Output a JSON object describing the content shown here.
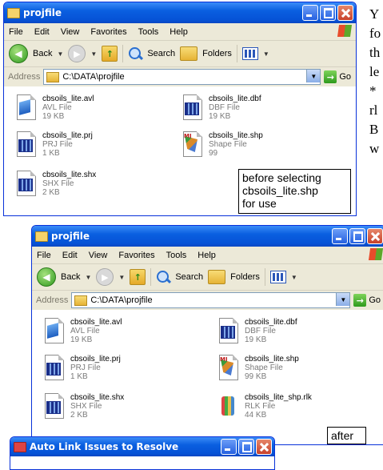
{
  "bg_text": [
    "Y",
    "fo",
    "th",
    "le",
    "*",
    "rl",
    "B",
    "w"
  ],
  "top_window": {
    "title": "projfile",
    "menu": [
      "File",
      "Edit",
      "View",
      "Favorites",
      "Tools",
      "Help"
    ],
    "toolbar": {
      "back": "Back",
      "search": "Search",
      "folders": "Folders"
    },
    "address": {
      "label": "Address",
      "path": "C:\\DATA\\projfile",
      "go": "Go"
    },
    "files": [
      {
        "name": "cbsoils_lite.avl",
        "type": "AVL File",
        "size": "19 KB",
        "icon": "avl-file-icon"
      },
      {
        "name": "cbsoils_lite.dbf",
        "type": "DBF File",
        "size": "19 KB",
        "icon": "dbf-file-icon"
      },
      {
        "name": "cbsoils_lite.prj",
        "type": "PRJ File",
        "size": "1 KB",
        "icon": "prj-file-icon"
      },
      {
        "name": "cbsoils_lite.shp",
        "type": "Shape File",
        "size": "99",
        "icon": "shape-file-icon"
      },
      {
        "name": "cbsoils_lite.shx",
        "type": "SHX File",
        "size": "2 KB",
        "icon": "shx-file-icon"
      }
    ]
  },
  "note_before": [
    "before selecting",
    "cbsoils_lite.shp",
    "for use"
  ],
  "bottom_window": {
    "title": "projfile",
    "menu": [
      "File",
      "Edit",
      "View",
      "Favorites",
      "Tools",
      "Help"
    ],
    "toolbar": {
      "back": "Back",
      "search": "Search",
      "folders": "Folders"
    },
    "address": {
      "label": "Address",
      "path": "C:\\DATA\\projfile",
      "go": "Go"
    },
    "files": [
      {
        "name": "cbsoils_lite.avl",
        "type": "AVL File",
        "size": "19 KB",
        "icon": "avl-file-icon"
      },
      {
        "name": "cbsoils_lite.dbf",
        "type": "DBF File",
        "size": "19 KB",
        "icon": "dbf-file-icon"
      },
      {
        "name": "cbsoils_lite.prj",
        "type": "PRJ File",
        "size": "1 KB",
        "icon": "prj-file-icon"
      },
      {
        "name": "cbsoils_lite.shp",
        "type": "Shape File",
        "size": "99 KB",
        "icon": "shape-file-icon"
      },
      {
        "name": "cbsoils_lite.shx",
        "type": "SHX File",
        "size": "2 KB",
        "icon": "shx-file-icon"
      },
      {
        "name": "cbsoils_lite_shp.rlk",
        "type": "RLK File",
        "size": "44 KB",
        "icon": "rlk-file-icon"
      }
    ]
  },
  "note_after": "after",
  "dialog": {
    "title": "Auto Link Issues to Resolve"
  }
}
